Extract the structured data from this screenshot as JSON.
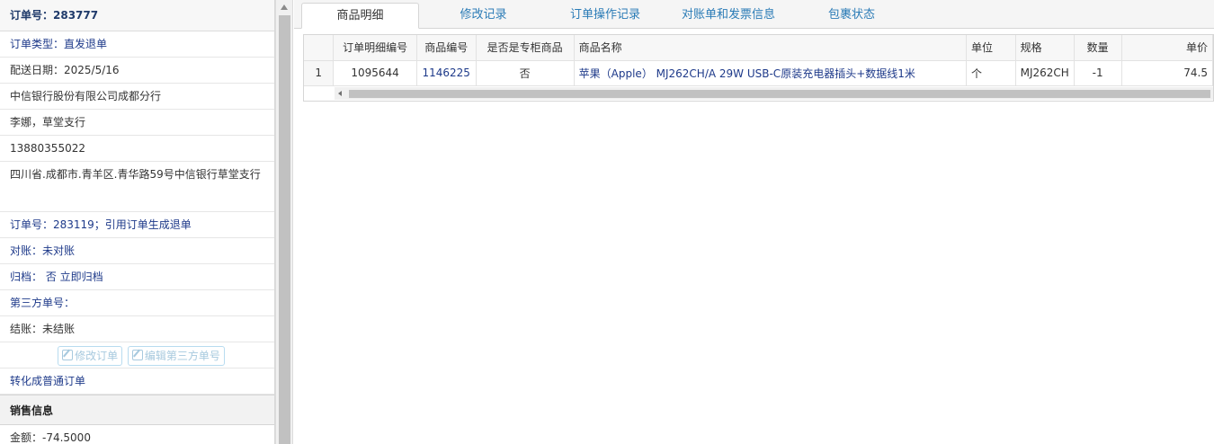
{
  "order": {
    "title": "订单号：283777",
    "type": "订单类型：直发退单",
    "date": "配送日期：2025/5/16",
    "company": "中信银行股份有限公司成都分行",
    "contact": "李娜，草堂支行",
    "phone": "13880355022",
    "address": "四川省.成都市.青羊区.青华路59号中信银行草堂支行",
    "ref_order": "订单号：283119；引用订单生成退单",
    "reconcile": "对账：未对账",
    "archive": "归档： 否 立即归档",
    "third_party": "第三方单号：",
    "settle": "结账：未结账",
    "btn_edit": "修改订单",
    "btn_edit_third": "编辑第三方单号",
    "convert_link": "转化成普通订单",
    "sales_section": "销售信息",
    "amount": "金额：-74.5000"
  },
  "tabs": [
    {
      "label": "商品明细"
    },
    {
      "label": "修改记录"
    },
    {
      "label": "订单操作记录"
    },
    {
      "label": "对账单和发票信息"
    },
    {
      "label": "包裹状态"
    }
  ],
  "grid": {
    "headers": [
      "",
      "订单明细编号",
      "商品编号",
      "是否是专柜商品",
      "商品名称",
      "单位",
      "规格",
      "数量",
      "单价"
    ],
    "rows": [
      {
        "num": "1",
        "detail_id": "1095644",
        "product_id": "1146225",
        "counter": "否",
        "name": "苹果（Apple） MJ262CH/A 29W USB-C原装充电器插头+数据线1米",
        "unit": "个",
        "spec": "MJ262CH",
        "qty": "-1",
        "price": "74.5"
      }
    ]
  }
}
